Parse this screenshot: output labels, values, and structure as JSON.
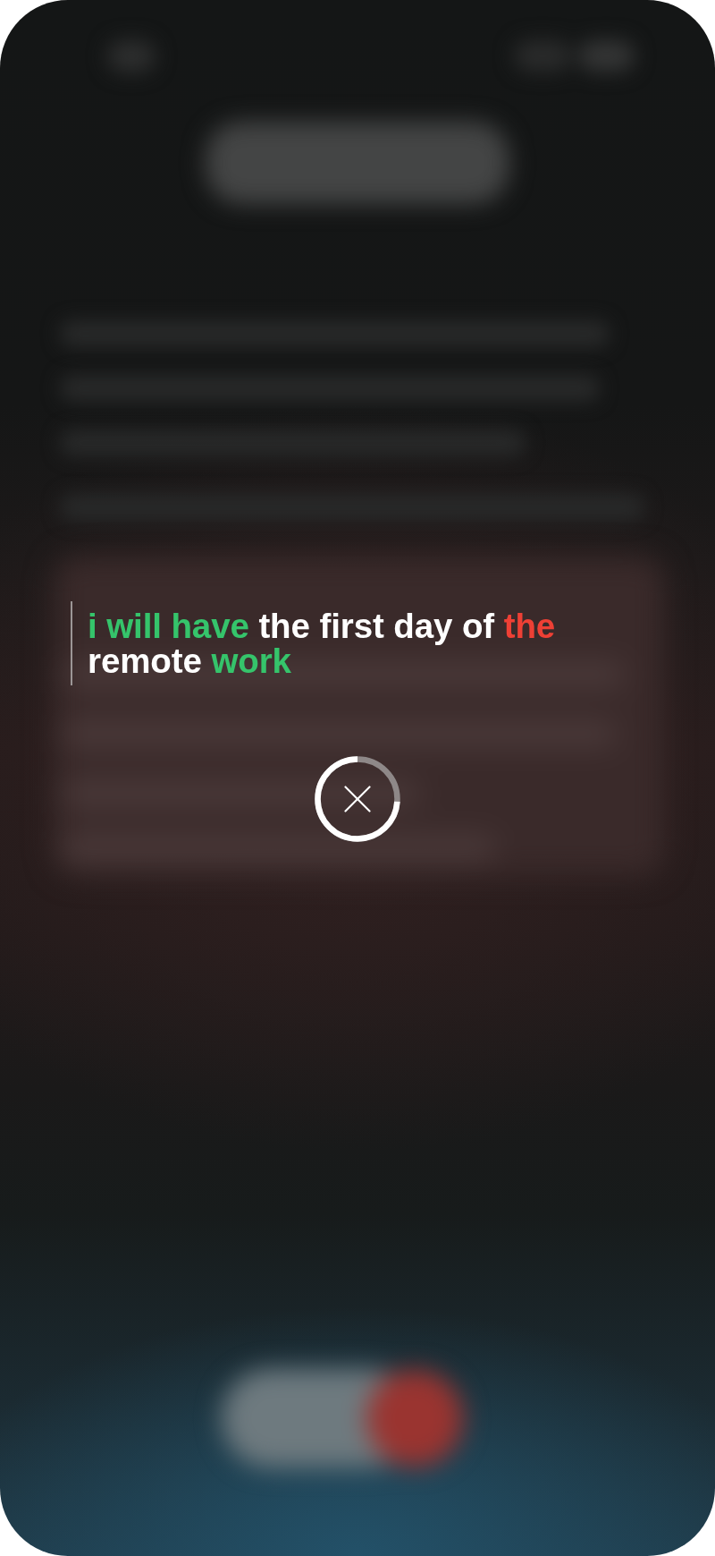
{
  "transcript": {
    "segments": [
      {
        "text": "i will have",
        "color": "#35c46b"
      },
      {
        "text": "the first day of",
        "color": "#ffffff"
      },
      {
        "text": "the",
        "color": "#ee4035"
      },
      {
        "text": "remote",
        "color": "#ffffff"
      },
      {
        "text": "work",
        "color": "#35c46b"
      }
    ]
  },
  "countdown": {
    "level": 0.74
  }
}
